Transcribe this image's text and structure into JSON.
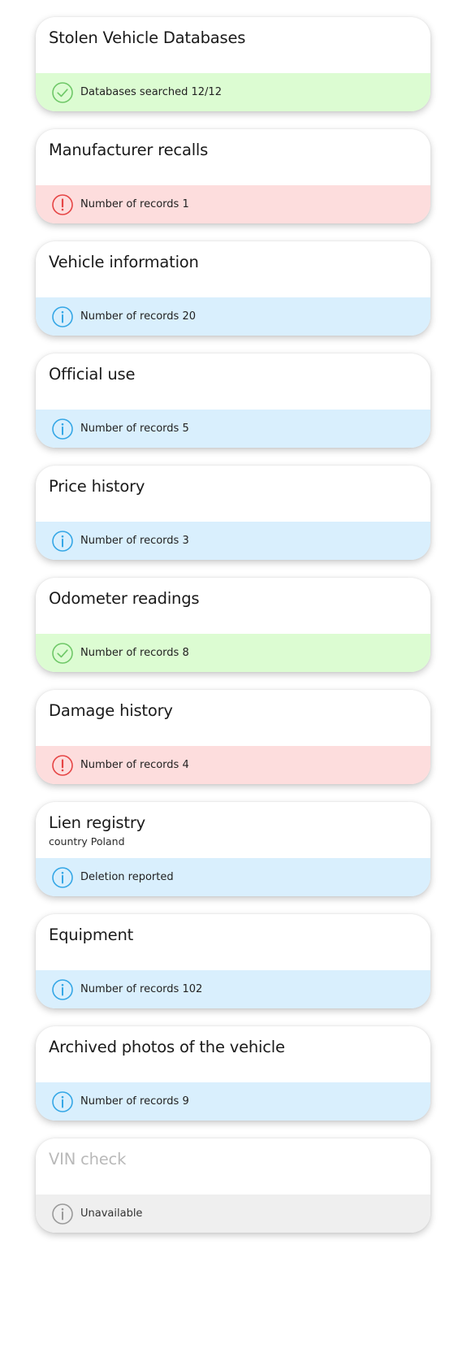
{
  "colors": {
    "ok_bg": "#dcfcd2",
    "ok_icon": "#6fc868",
    "warn_bg": "#fddddd",
    "warn_icon": "#e64545",
    "info_bg": "#d9effd",
    "info_icon": "#35a7e6",
    "off_bg": "#efefef",
    "off_icon": "#9a9a9a"
  },
  "cards": [
    {
      "title": "Stolen Vehicle Databases",
      "status_text": "Databases searched 12/12",
      "icon": "check-circle-icon"
    },
    {
      "title": "Manufacturer recalls",
      "status_text": "Number of records 1",
      "icon": "exclamation-circle-icon"
    },
    {
      "title": "Vehicle information",
      "status_text": "Number of records 20",
      "icon": "info-circle-icon"
    },
    {
      "title": "Official use",
      "status_text": "Number of records 5",
      "icon": "info-circle-icon"
    },
    {
      "title": "Price history",
      "status_text": "Number of records 3",
      "icon": "info-circle-icon"
    },
    {
      "title": "Odometer readings",
      "status_text": "Number of records 8",
      "icon": "check-circle-icon"
    },
    {
      "title": "Damage history",
      "status_text": "Number of records 4",
      "icon": "exclamation-circle-icon"
    },
    {
      "title": "Lien registry",
      "subtitle": "country Poland",
      "status_text": "Deletion reported",
      "icon": "info-circle-icon"
    },
    {
      "title": "Equipment",
      "status_text": "Number of records 102",
      "icon": "info-circle-icon"
    },
    {
      "title": "Archived photos of the vehicle",
      "status_text": "Number of records 9",
      "icon": "info-circle-icon"
    },
    {
      "title": "VIN check",
      "status_text": "Unavailable",
      "icon": "info-circle-icon"
    }
  ]
}
